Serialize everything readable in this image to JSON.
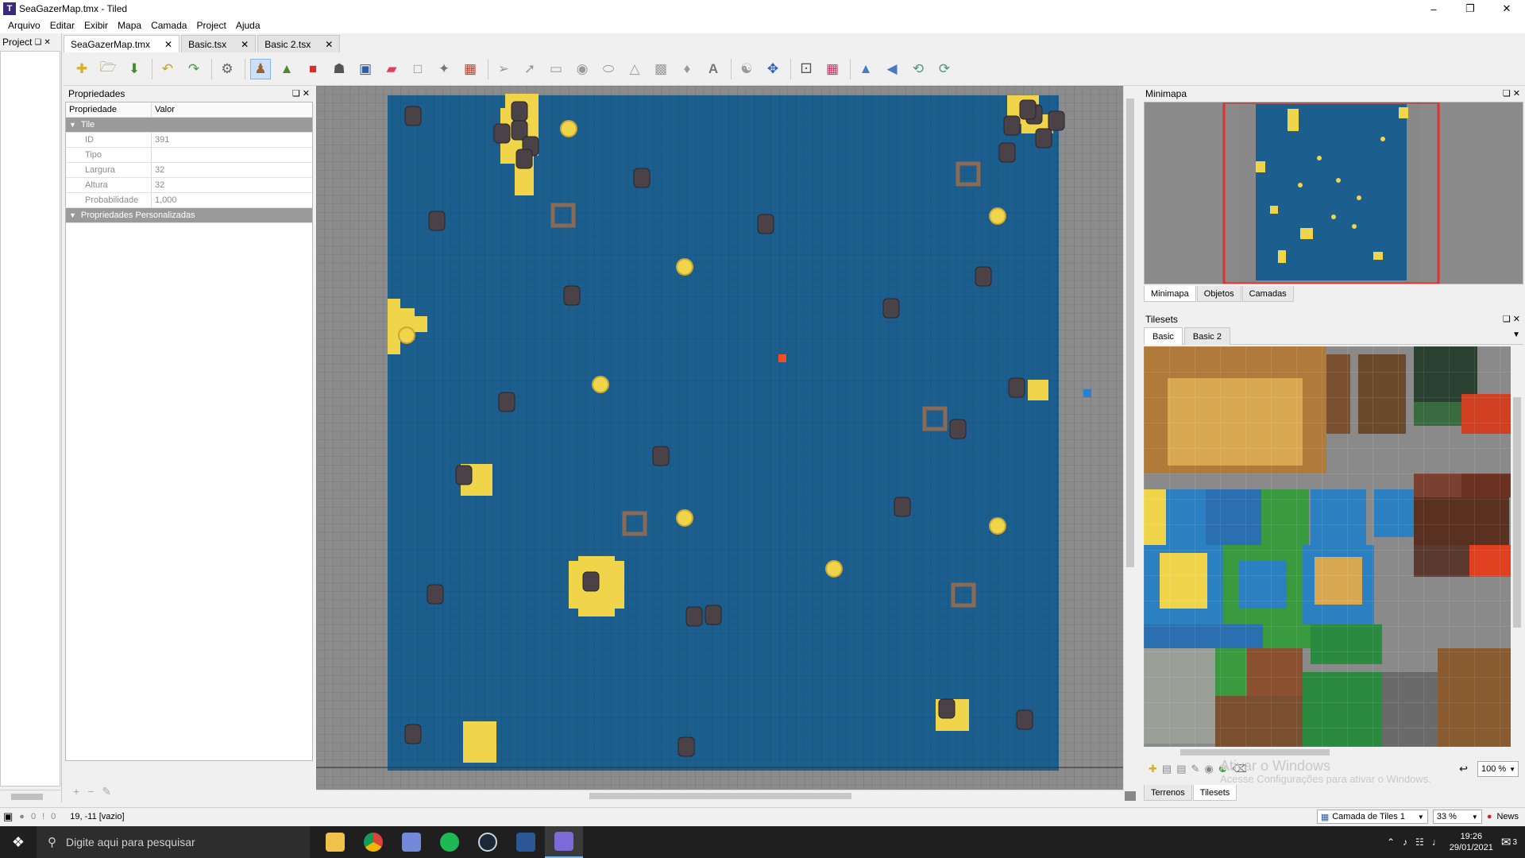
{
  "window": {
    "title": "SeaGazerMap.tmx - Tiled",
    "app_icon": "tiled-icon"
  },
  "menu": [
    "Arquivo",
    "Editar",
    "Exibir",
    "Mapa",
    "Camada",
    "Project",
    "Ajuda"
  ],
  "project_panel": {
    "title": "Project"
  },
  "doc_tabs": [
    {
      "label": "SeaGazerMap.tmx"
    },
    {
      "label": "Basic.tsx"
    },
    {
      "label": "Basic 2.tsx"
    }
  ],
  "properties": {
    "title": "Propriedades",
    "col_property": "Propriedade",
    "col_value": "Valor",
    "group_tile": "Tile",
    "rows": [
      {
        "name": "ID",
        "value": "391"
      },
      {
        "name": "Tipo",
        "value": ""
      },
      {
        "name": "Largura",
        "value": "32"
      },
      {
        "name": "Altura",
        "value": "32"
      },
      {
        "name": "Probabilidade",
        "value": "1,000"
      }
    ],
    "group_custom": "Propriedades Personalizadas"
  },
  "minimap": {
    "title": "Minimapa",
    "tabs": [
      "Minimapa",
      "Objetos",
      "Camadas"
    ]
  },
  "tilesets": {
    "title": "Tilesets",
    "tabs": [
      "Basic",
      "Basic 2"
    ],
    "zoom": "100 %",
    "bottom_tabs": [
      "Terrenos",
      "Tilesets"
    ],
    "watermark_title": "Ativar o Windows",
    "watermark_sub": "Acesse Configurações para ativar o Windows."
  },
  "status": {
    "errors": "0",
    "warnings": "0",
    "coords": "19, -11 [vazio]",
    "layer": "Camada de Tiles 1",
    "zoom": "33 %",
    "news": "News"
  },
  "taskbar": {
    "search_placeholder": "Digite aqui para pesquisar",
    "time": "19:26",
    "date": "29/01/2021",
    "notifications": "3"
  },
  "colors": {
    "water": "#1c5f8f",
    "sand": "#f0d54a",
    "rock": "#4b4248",
    "border_grey": "#8a8a8a",
    "minimap_frame": "#e03030"
  }
}
